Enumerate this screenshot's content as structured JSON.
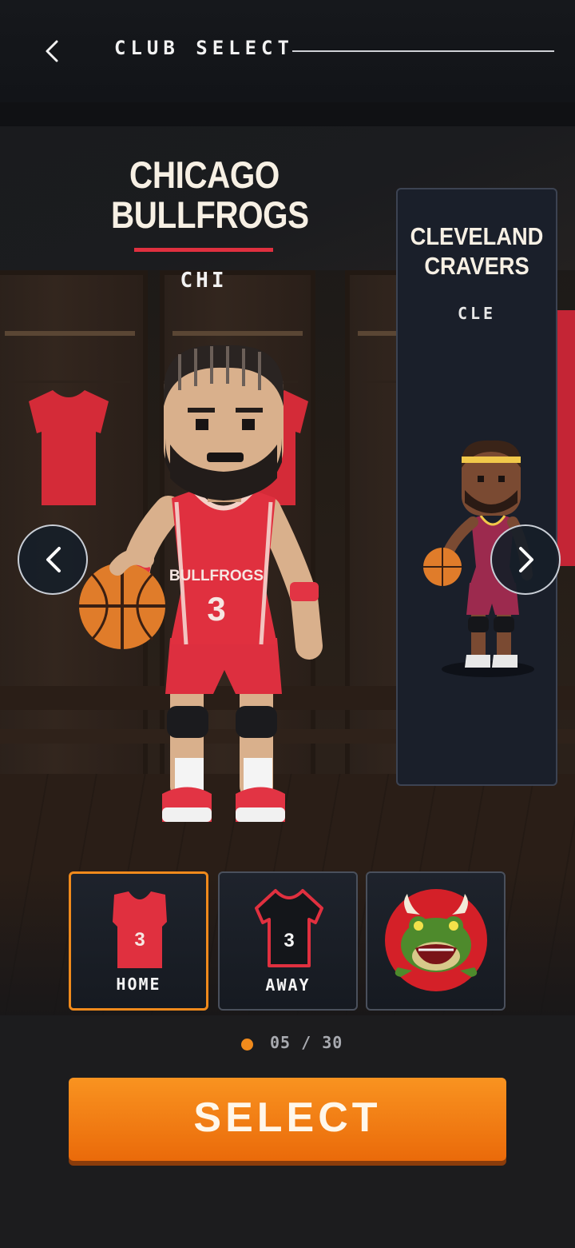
{
  "header": {
    "title": "CLUB SELECT"
  },
  "current_team": {
    "name_line1": "CHICAGO",
    "name_line2": "BULLFROGS",
    "abbr": "CHI",
    "jersey_text": "BULLFROGS",
    "jersey_number": "3",
    "accent": "#e0303f"
  },
  "next_team": {
    "name_line1": "CLEVELAND",
    "name_line2": "CRAVERS",
    "abbr": "CLE",
    "accent": "#8c1f3e"
  },
  "kits": [
    {
      "label": "HOME",
      "number": "3"
    },
    {
      "label": "AWAY",
      "number": "3"
    },
    {
      "label": ""
    }
  ],
  "pager": {
    "text": "05 / 30"
  },
  "actions": {
    "select": "SELECT"
  },
  "colors": {
    "primary": "#f08a1c",
    "home_red": "#e0303f",
    "background": "#1c1c1e"
  },
  "icons": {
    "back": "chevron-left-icon",
    "prev": "chevron-left-icon",
    "next": "chevron-right-icon",
    "logo": "bullfrog-logo"
  }
}
